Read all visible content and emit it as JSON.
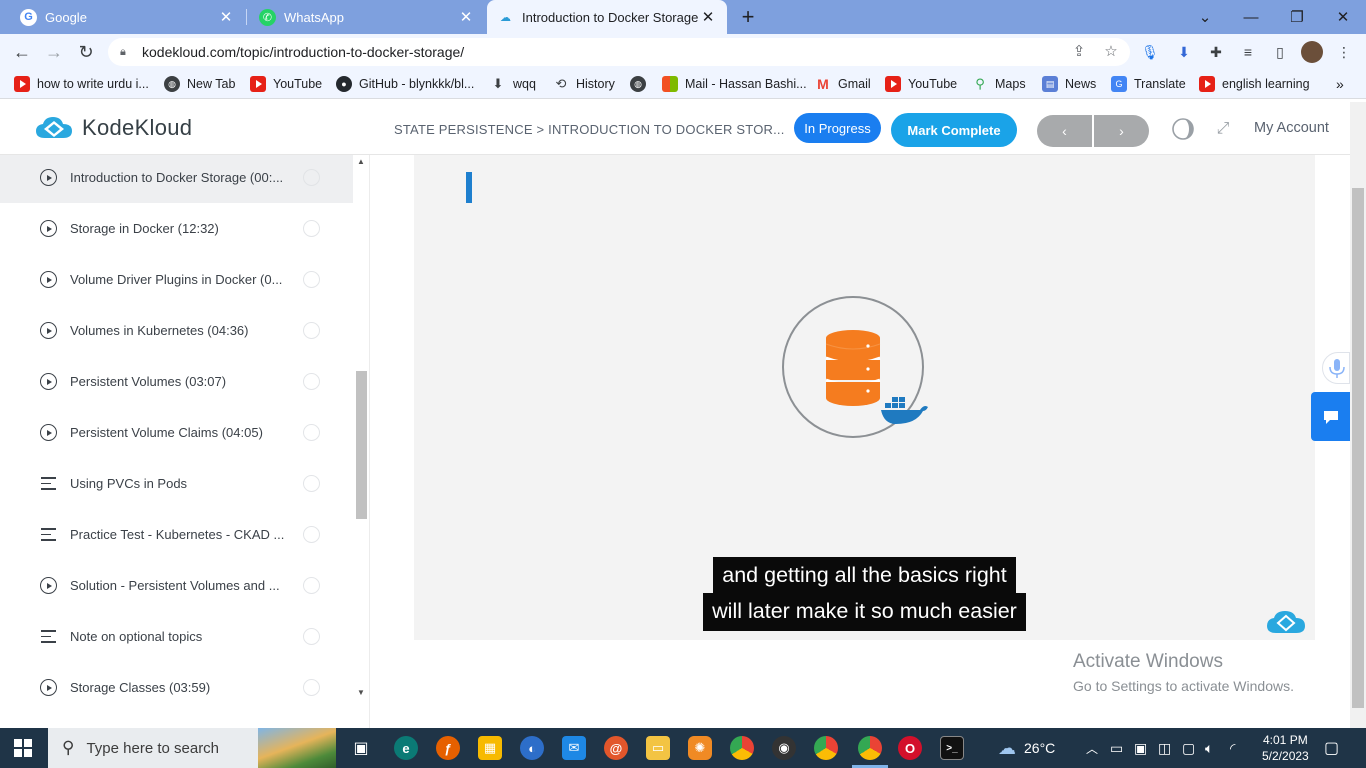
{
  "browser": {
    "tabs": [
      {
        "title": "Google",
        "icon": "google-icon",
        "active": false
      },
      {
        "title": "WhatsApp",
        "icon": "whatsapp-icon",
        "active": false
      },
      {
        "title": "Introduction to Docker Storage -",
        "icon": "kodekloud-icon",
        "active": true
      }
    ],
    "url": "kodekloud.com/topic/introduction-to-docker-storage/",
    "bookmarks": [
      {
        "label": "how to write urdu i...",
        "icon": "youtube-icon"
      },
      {
        "label": "New Tab",
        "icon": "globe-icon"
      },
      {
        "label": "YouTube",
        "icon": "youtube-icon"
      },
      {
        "label": "GitHub - blynkkk/bl...",
        "icon": "github-icon"
      },
      {
        "label": "wqq",
        "icon": "download-icon"
      },
      {
        "label": "History",
        "icon": "history-icon"
      },
      {
        "label": "",
        "icon": "globe-icon"
      },
      {
        "label": "Mail - Hassan Bashi...",
        "icon": "microsoft-icon"
      },
      {
        "label": "Gmail",
        "icon": "gmail-icon"
      },
      {
        "label": "YouTube",
        "icon": "youtube-icon"
      },
      {
        "label": "Maps",
        "icon": "maps-icon"
      },
      {
        "label": "News",
        "icon": "news-icon"
      },
      {
        "label": "Translate",
        "icon": "translate-icon"
      },
      {
        "label": "english learning",
        "icon": "youtube-icon"
      }
    ]
  },
  "header": {
    "logo_text": "KodeKloud",
    "breadcrumb": "STATE PERSISTENCE > INTRODUCTION TO DOCKER STOR...",
    "status_label": "In Progress",
    "complete_label": "Mark Complete",
    "prev_label": "‹",
    "next_label": "›",
    "account_label": "My Account"
  },
  "sidebar": {
    "lessons": [
      {
        "label": "Introduction to Docker Storage (00:...",
        "type": "video",
        "current": true
      },
      {
        "label": "Storage in Docker (12:32)",
        "type": "video",
        "current": false
      },
      {
        "label": "Volume Driver Plugins in Docker (0...",
        "type": "video",
        "current": false
      },
      {
        "label": "Volumes in Kubernetes (04:36)",
        "type": "video",
        "current": false
      },
      {
        "label": "Persistent Volumes (03:07)",
        "type": "video",
        "current": false
      },
      {
        "label": "Persistent Volume Claims (04:05)",
        "type": "video",
        "current": false
      },
      {
        "label": "Using PVCs in Pods",
        "type": "text",
        "current": false
      },
      {
        "label": "Practice Test - Kubernetes - CKAD ...",
        "type": "text",
        "current": false
      },
      {
        "label": "Solution - Persistent Volumes and ...",
        "type": "video",
        "current": false
      },
      {
        "label": "Note on optional topics",
        "type": "text",
        "current": false
      },
      {
        "label": "Storage Classes (03:59)",
        "type": "video",
        "current": false
      }
    ]
  },
  "video": {
    "caption_line1": "and getting all the basics right",
    "caption_line2": "will later make it so much easier"
  },
  "watermark": {
    "line1": "Activate Windows",
    "line2": "Go to Settings to activate Windows."
  },
  "taskbar": {
    "search_placeholder": "Type here to search",
    "weather": "26°C",
    "time": "4:01 PM",
    "date": "5/2/2023"
  },
  "colors": {
    "brand_blue": "#1a7ef0",
    "complete_blue": "#1aa3e8",
    "db_orange": "#f57c1f",
    "tab_strip": "#7ea0de"
  }
}
